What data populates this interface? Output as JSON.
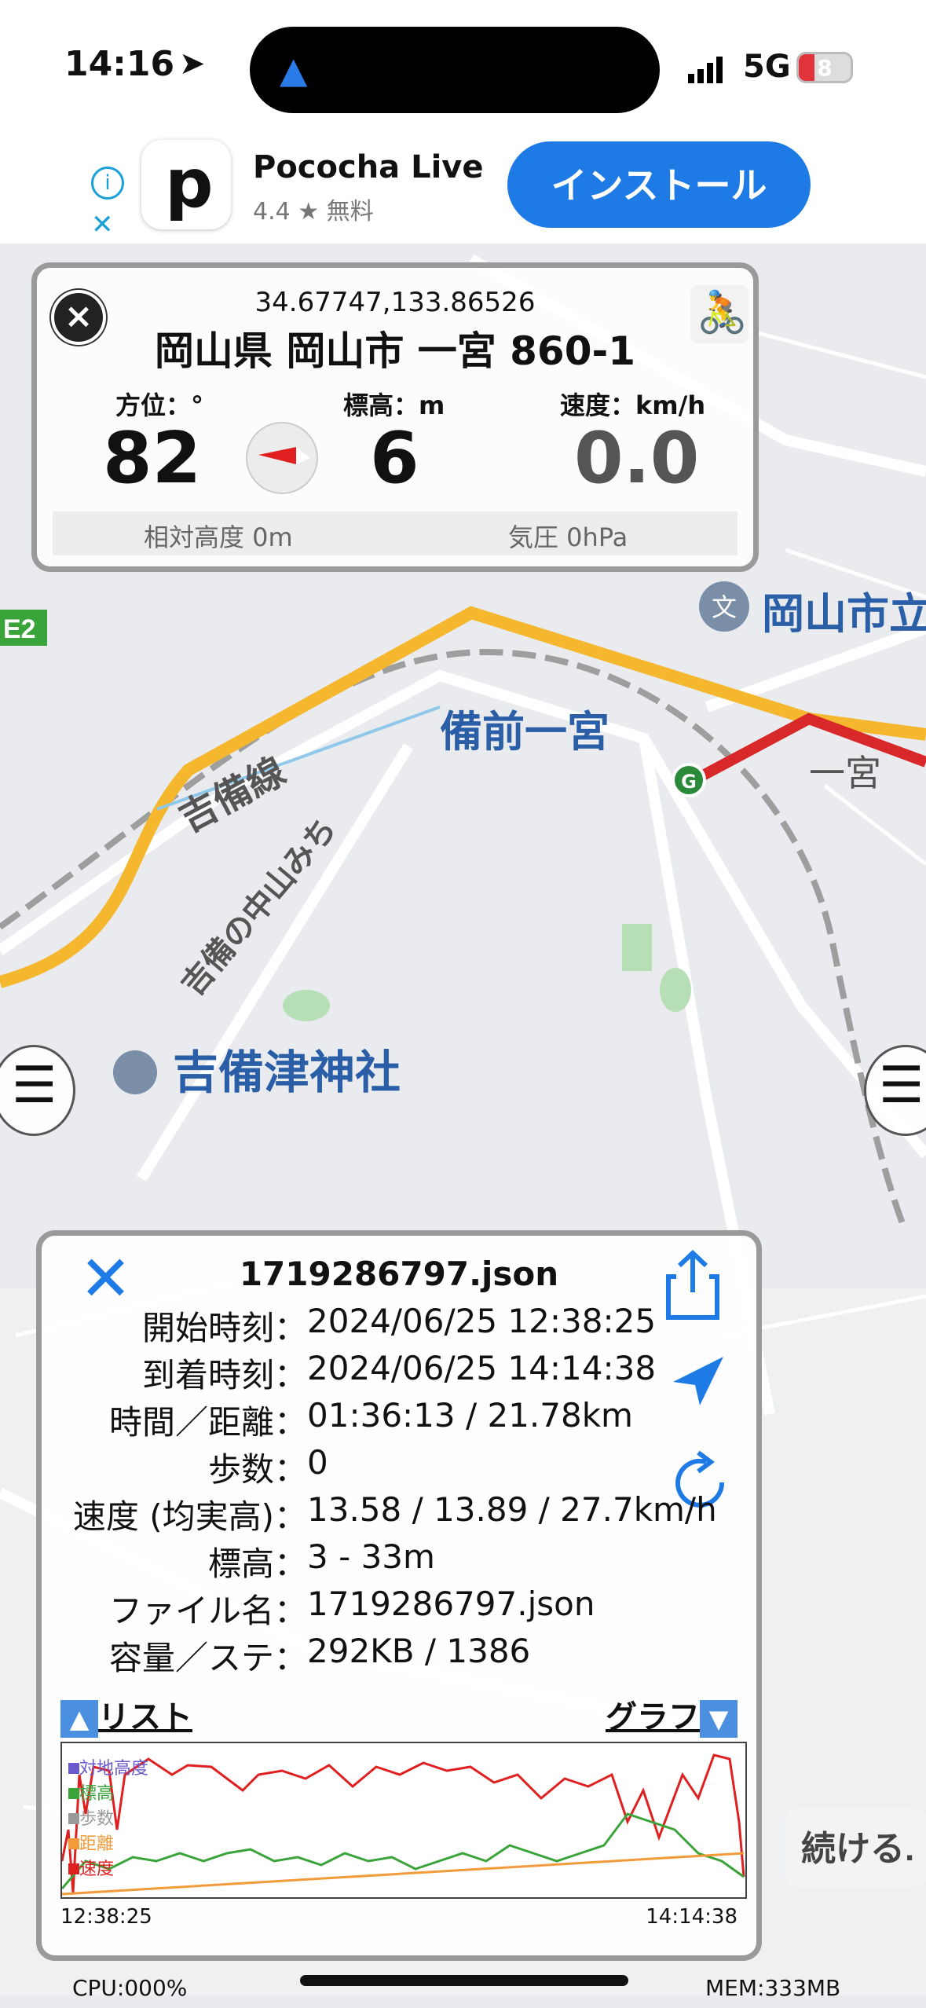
{
  "status_bar": {
    "time": "14:16",
    "network": "5G",
    "battery": "8"
  },
  "ad": {
    "app_name": "Pococha Live",
    "rating": "4.4 ★ 無料",
    "install_label": "インストール"
  },
  "location_panel": {
    "coords": "34.67747,133.86526",
    "address": "岡山県 岡山市 一宮 860-1",
    "heading_label": "方位：°",
    "heading_value": "82",
    "altitude_label": "標高：m",
    "altitude_value": "6",
    "speed_label": "速度：km/h",
    "speed_value": "0.0",
    "relative_altitude": "相対高度 0m",
    "pressure": "気圧 0hPa"
  },
  "map": {
    "labels": {
      "station": "備前一宮",
      "line": "吉備線",
      "road": "吉備の中山みち",
      "shrine": "吉備津神社",
      "ichinomiya": "一宮",
      "school": "岡山市立",
      "road_e2": "E2",
      "tsuzukeru": "続ける."
    },
    "accent_route": "#d8282a",
    "rail_color": "#f5b72e"
  },
  "track_panel": {
    "file_name": "1719286797.json",
    "rows": [
      {
        "key": "開始時刻：",
        "value": "2024/06/25 12:38:25"
      },
      {
        "key": "到着時刻：",
        "value": "2024/06/25 14:14:38"
      },
      {
        "key": "時間／距離：",
        "value": "01:36:13 / 21.78km"
      },
      {
        "key": "歩数：",
        "value": "0"
      },
      {
        "key": "速度 (均実高)：",
        "value": "13.58 / 13.89 / 27.7km/h"
      },
      {
        "key": "標高：",
        "value": "3 - 33m"
      },
      {
        "key": "ファイル名：",
        "value": "1719286797.json"
      },
      {
        "key": "容量／ステ：",
        "value": "292KB / 1386"
      }
    ],
    "list_label": "リスト",
    "graph_label": "グラフ",
    "legend": [
      "対地高度",
      "標高",
      "歩数",
      "距離",
      "速度"
    ],
    "legend_colors": [
      "#6a5acd",
      "#3aa43a",
      "#999999",
      "#f39a3a",
      "#e02020"
    ],
    "start_time": "12:38:25",
    "end_time": "14:14:38"
  },
  "footer": {
    "cpu": "CPU:000%",
    "mem": "MEM:333MB"
  }
}
